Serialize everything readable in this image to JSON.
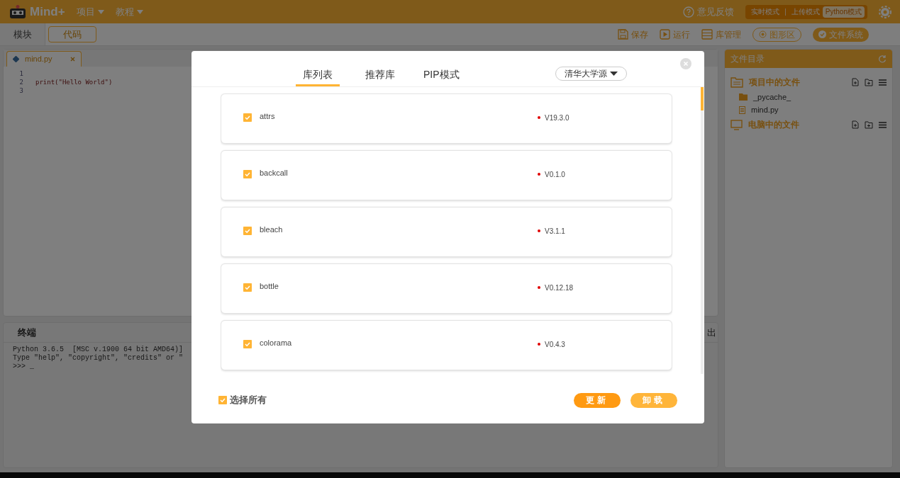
{
  "app": {
    "logo": "Mind+",
    "menus": [
      "项目",
      "教程"
    ],
    "feedback": "意见反馈",
    "modes": [
      {
        "label": "实时模式",
        "selected": false
      },
      {
        "label": "上传模式",
        "selected": false
      },
      {
        "label": "Python模式",
        "selected": true
      }
    ]
  },
  "view_tabs": [
    {
      "label": "模块",
      "selected": false
    },
    {
      "label": "代码",
      "selected": true
    }
  ],
  "toolbar": [
    {
      "label": "保存",
      "kind": "save"
    },
    {
      "label": "运行",
      "kind": "run"
    },
    {
      "label": "库管理",
      "kind": "library"
    },
    {
      "label": "图形区",
      "kind": "toggle",
      "on": false
    },
    {
      "label": "文件系统",
      "kind": "toggle",
      "on": true
    }
  ],
  "editor": {
    "tab": "mind.py",
    "lines": [
      {
        "number": "1"
      },
      {
        "number": "2",
        "code": "print(\"Hello World\")"
      },
      {
        "number": "3"
      }
    ]
  },
  "terminal": {
    "title": "终端",
    "column_2": "出",
    "lines": [
      "Python 3.6.5  [MSC v.1900 64 bit AMD64)]",
      "Type \"help\", \"copyright\", \"credits\" or \"",
      ">>> _"
    ]
  },
  "files": {
    "title": "文件目录",
    "sections": [
      {
        "label": "项目中的文件",
        "kind": "project",
        "children": [
          {
            "name": "_pycache_",
            "kind": "folder"
          },
          {
            "name": "mind.py",
            "kind": "file"
          }
        ]
      },
      {
        "label": "电脑中的文件",
        "kind": "computer"
      }
    ]
  },
  "dialog": {
    "tabs": [
      {
        "label": "库列表",
        "selected": true
      },
      {
        "label": "推荐库",
        "selected": false
      },
      {
        "label": "PIP模式",
        "selected": false
      }
    ],
    "source": "清华大学源",
    "libraries": [
      {
        "name": "attrs",
        "version": "V19.3.0",
        "checked": true
      },
      {
        "name": "backcall",
        "version": "V0.1.0",
        "checked": true
      },
      {
        "name": "bleach",
        "version": "V3.1.1",
        "checked": true
      },
      {
        "name": "bottle",
        "version": "V0.12.18",
        "checked": true
      },
      {
        "name": "colorama",
        "version": "V0.4.3",
        "checked": true
      }
    ],
    "select_all": {
      "label": "选择所有",
      "checked": true
    },
    "buttons": [
      "更新",
      "卸载"
    ]
  }
}
